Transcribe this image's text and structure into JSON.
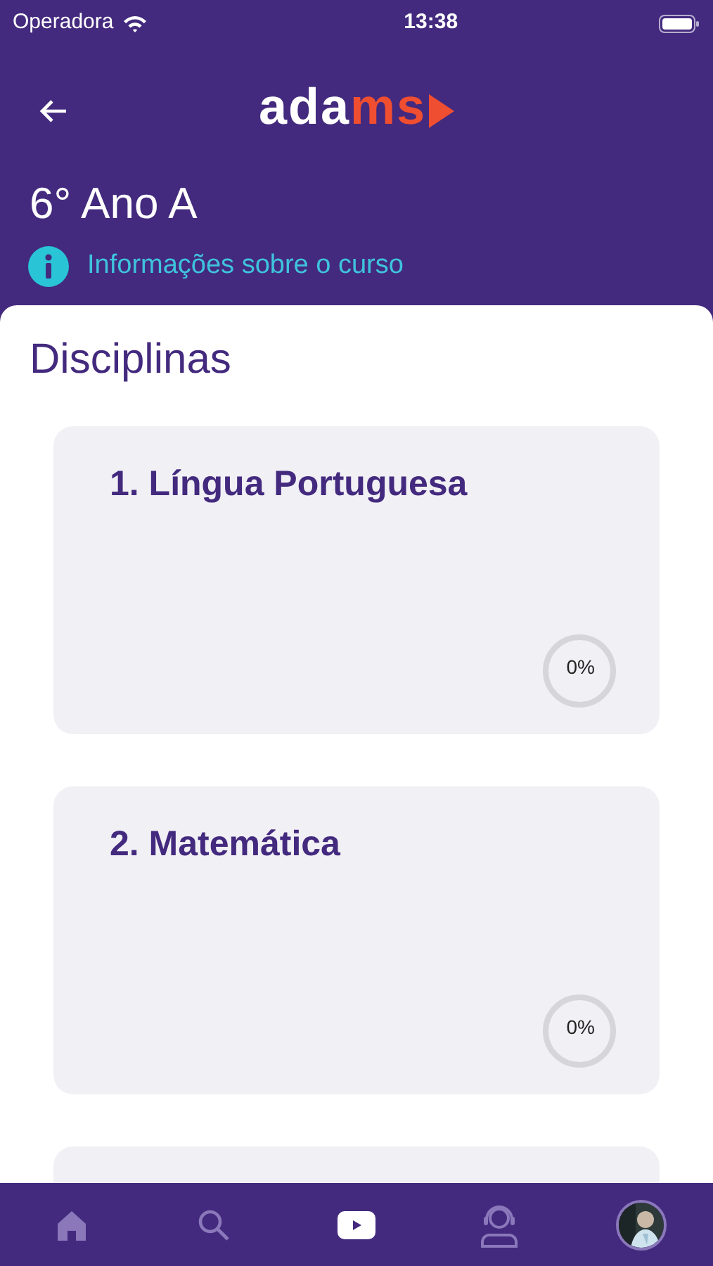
{
  "status_bar": {
    "carrier": "Operadora",
    "time": "13:38"
  },
  "header": {
    "logo": [
      {
        "text": "ada",
        "color": "#ffffff"
      },
      {
        "text": "ms",
        "color": "#f04e30"
      }
    ],
    "title": "6° Ano A",
    "info_link": "Informações sobre o curso"
  },
  "section_title": "Disciplinas",
  "subjects": [
    {
      "name": "1. Língua Portuguesa",
      "level": 0,
      "progress": "0%"
    },
    {
      "name": "2. Matemática",
      "level": 0,
      "progress": "0%"
    }
  ],
  "tab_bar": [
    {
      "kind": "home",
      "selected": false
    },
    {
      "kind": "search",
      "selected": false
    },
    {
      "kind": "video",
      "selected": true
    },
    {
      "kind": "support",
      "selected": false
    },
    {
      "kind": "profile",
      "selected": false
    }
  ]
}
